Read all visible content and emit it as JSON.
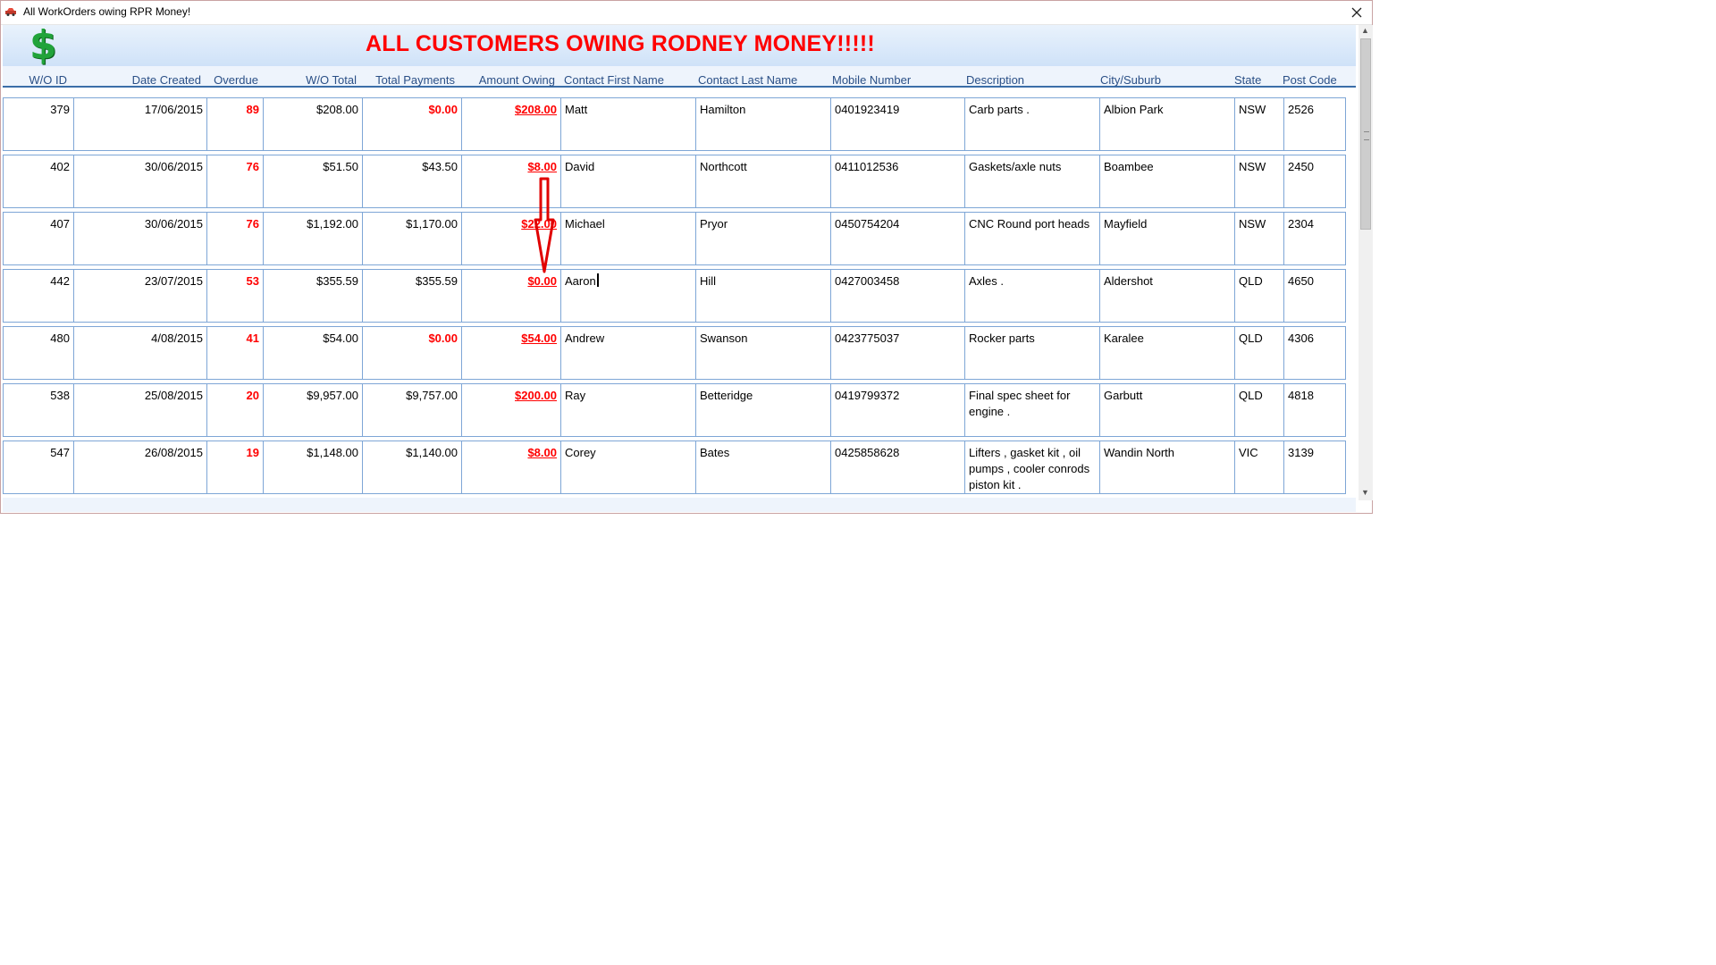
{
  "window": {
    "title": "All WorkOrders owing RPR Money!",
    "close_label": "✕"
  },
  "header": {
    "dollar_symbol": "$",
    "headline": "ALL CUSTOMERS OWING RODNEY MONEY!!!!!"
  },
  "columns": [
    "W/O ID",
    "Date Created",
    "Overdue",
    "W/O Total",
    "Total Payments",
    "Amount Owing",
    "Contact First Name",
    "Contact Last Name",
    "Mobile Number",
    "Description",
    "City/Suburb",
    "State",
    "Post Code"
  ],
  "rows": [
    {
      "id": "379",
      "date": "17/06/2015",
      "overdue": "89",
      "total": "$208.00",
      "payments": "$0.00",
      "owing": "$208.00",
      "first": "Matt",
      "last": "Hamilton",
      "mobile": "0401923419",
      "desc": "Carb parts .",
      "city": "Albion Park",
      "state": "NSW",
      "post": "2526",
      "payments_red": true
    },
    {
      "id": "402",
      "date": "30/06/2015",
      "overdue": "76",
      "total": "$51.50",
      "payments": "$43.50",
      "owing": "$8.00",
      "first": "David",
      "last": "Northcott",
      "mobile": "0411012536",
      "desc": "Gaskets/axle nuts",
      "city": "Boambee",
      "state": "NSW",
      "post": "2450",
      "payments_red": false
    },
    {
      "id": "407",
      "date": "30/06/2015",
      "overdue": "76",
      "total": "$1,192.00",
      "payments": "$1,170.00",
      "owing": "$22.00",
      "first": "Michael",
      "last": "Pryor",
      "mobile": "0450754204",
      "desc": "CNC Round port heads",
      "city": "Mayfield",
      "state": "NSW",
      "post": "2304",
      "payments_red": false
    },
    {
      "id": "442",
      "date": "23/07/2015",
      "overdue": "53",
      "total": "$355.59",
      "payments": "$355.59",
      "owing": "$0.00",
      "first": "Aaron",
      "last": "Hill",
      "mobile": "0427003458",
      "desc": " Axles .",
      "city": "Aldershot",
      "state": "QLD",
      "post": "4650",
      "payments_red": false
    },
    {
      "id": "480",
      "date": "4/08/2015",
      "overdue": "41",
      "total": "$54.00",
      "payments": "$0.00",
      "owing": "$54.00",
      "first": "Andrew",
      "last": "Swanson",
      "mobile": "0423775037",
      "desc": "Rocker parts",
      "city": "Karalee",
      "state": "QLD",
      "post": "4306",
      "payments_red": true
    },
    {
      "id": "538",
      "date": "25/08/2015",
      "overdue": "20",
      "total": "$9,957.00",
      "payments": "$9,757.00",
      "owing": "$200.00",
      "first": "Ray",
      "last": "Betteridge",
      "mobile": "0419799372",
      "desc": "Final spec sheet for engine .",
      "city": "Garbutt",
      "state": "QLD",
      "post": "4818",
      "payments_red": false
    },
    {
      "id": "547",
      "date": "26/08/2015",
      "overdue": "19",
      "total": "$1,148.00",
      "payments": "$1,140.00",
      "owing": "$8.00",
      "first": "Corey",
      "last": "Bates",
      "mobile": "0425858628",
      "desc": "Lifters , gasket kit , oil pumps , cooler conrods piston kit .",
      "city": "Wandin North",
      "state": "VIC",
      "post": "3139",
      "payments_red": false
    }
  ],
  "colors": {
    "accent_red": "#ff0000",
    "grid_border": "#7ea6d6",
    "header_text": "#2a4f86",
    "dollar_green": "#21a33a"
  }
}
